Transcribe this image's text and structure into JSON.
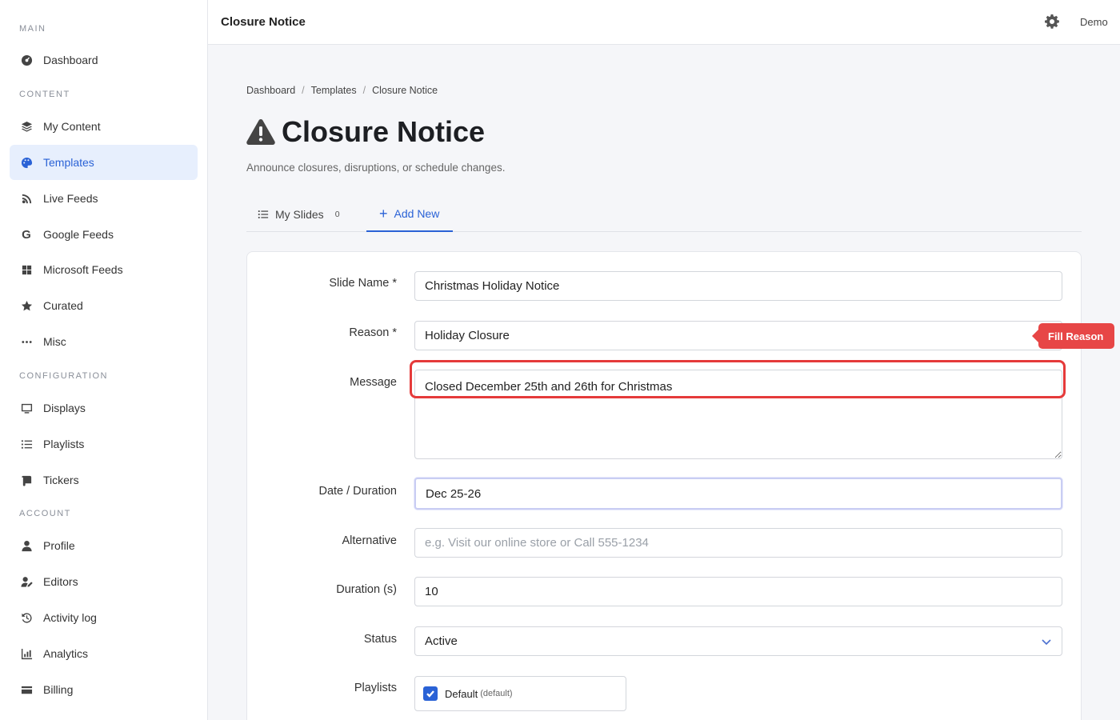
{
  "sidebar": {
    "sections": [
      "MAIN",
      "CONTENT",
      "CONFIGURATION",
      "ACCOUNT"
    ],
    "items": [
      {
        "label": "Dashboard",
        "icon": "dashboard-icon"
      },
      {
        "label": "My Content",
        "icon": "layers-icon"
      },
      {
        "label": "Templates",
        "icon": "palette-icon",
        "active": true
      },
      {
        "label": "Live Feeds",
        "icon": "broadcast-icon"
      },
      {
        "label": "Google Feeds",
        "icon": "google-icon"
      },
      {
        "label": "Microsoft Feeds",
        "icon": "windows-icon"
      },
      {
        "label": "Curated",
        "icon": "star-icon"
      },
      {
        "label": "Misc",
        "icon": "ellipsis-icon"
      },
      {
        "label": "Displays",
        "icon": "monitor-icon"
      },
      {
        "label": "Playlists",
        "icon": "list-icon"
      },
      {
        "label": "Tickers",
        "icon": "scroll-icon"
      },
      {
        "label": "Profile",
        "icon": "user-icon"
      },
      {
        "label": "Editors",
        "icon": "user-edit-icon"
      },
      {
        "label": "Activity log",
        "icon": "history-icon"
      },
      {
        "label": "Analytics",
        "icon": "chart-icon"
      },
      {
        "label": "Billing",
        "icon": "credit-card-icon"
      }
    ]
  },
  "header": {
    "title": "Closure Notice",
    "user": "Demo"
  },
  "breadcrumb": [
    "Dashboard",
    "Templates",
    "Closure Notice"
  ],
  "page": {
    "title": "Closure Notice",
    "subtitle": "Announce closures, disruptions, or schedule changes."
  },
  "tabs": {
    "my_slides": "My Slides",
    "my_slides_count": "0",
    "add_new": "Add New"
  },
  "form": {
    "slide_name_label": "Slide Name *",
    "slide_name_value": "Christmas Holiday Notice",
    "reason_label": "Reason *",
    "reason_value": "Holiday Closure",
    "message_label": "Message",
    "message_value": "Closed December 25th and 26th for Christmas",
    "date_label": "Date / Duration",
    "date_value": "Dec 25-26",
    "alternative_label": "Alternative",
    "alternative_placeholder": "e.g. Visit our online store or Call 555-1234",
    "duration_label": "Duration (s)",
    "duration_value": "10",
    "status_label": "Status",
    "status_value": "Active",
    "playlists_label": "Playlists",
    "playlist_name": "Default",
    "playlist_default": "(default)"
  },
  "annotation": {
    "tag": "Fill Reason"
  },
  "colors": {
    "accent": "#2a62d6",
    "highlight": "#e53a3a"
  }
}
